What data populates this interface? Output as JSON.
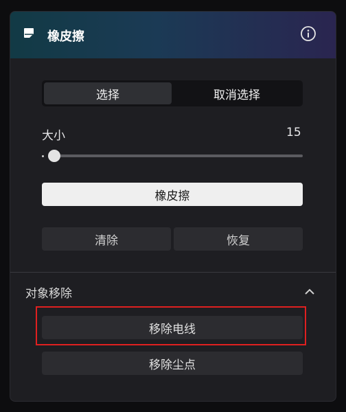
{
  "panel": {
    "title": "橡皮擦",
    "header_icon": "eraser-icon",
    "info_icon": "info-icon"
  },
  "mode_toggle": {
    "selected": "选择",
    "options": [
      "选择",
      "取消选择"
    ]
  },
  "size": {
    "label": "大小",
    "value": "15",
    "slider_fraction": 0.05
  },
  "buttons": {
    "eraser": "橡皮擦",
    "clear": "清除",
    "restore": "恢复"
  },
  "object_removal": {
    "title": "对象移除",
    "collapse_icon": "chevron-up-icon",
    "remove_wires": "移除电线",
    "remove_dust": "移除尘点"
  },
  "colors": {
    "highlight": "#e02020",
    "header_gradient": [
      "#123a45",
      "#2a2550"
    ]
  }
}
